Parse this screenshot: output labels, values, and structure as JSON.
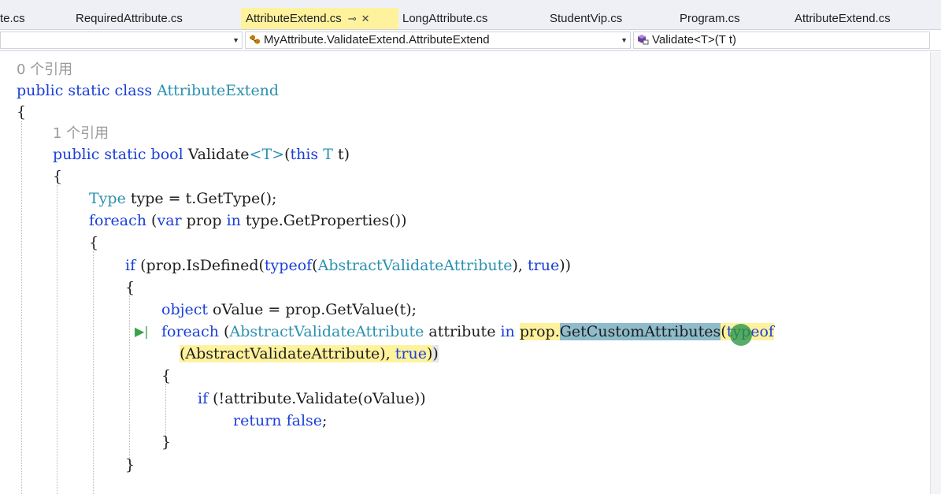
{
  "tabs": [
    {
      "label": "te.cs"
    },
    {
      "label": "RequiredAttribute.cs"
    },
    {
      "label": "AttributeExtend.cs",
      "active": true
    },
    {
      "label": "LongAttribute.cs"
    },
    {
      "label": "StudentVip.cs"
    },
    {
      "label": "Program.cs"
    },
    {
      "label": "AttributeExtend.cs"
    }
  ],
  "tab_controls": {
    "pin": "⊸",
    "close": "✕"
  },
  "nav": {
    "project_combo": "",
    "type_combo": "MyAttribute.ValidateExtend.AttributeExtend",
    "member_combo": "Validate<T>(T t)"
  },
  "code": {
    "ref0": "0 个引用",
    "l_class": {
      "kw1": "public",
      "kw2": "static",
      "kw3": "class",
      "name": "AttributeExtend"
    },
    "brace_open": "{",
    "brace_close": "}",
    "ref1": "1 个引用",
    "l_method": {
      "kw1": "public",
      "kw2": "static",
      "kw3": "bool",
      "name": "Validate",
      "lt": "<",
      "tparam": "T",
      "gt": ">",
      "open": "(",
      "kw_this": "this",
      "ptype": "T",
      "rest": " t)"
    },
    "l_type": {
      "ty": "Type",
      "rest": " type = t.GetType();"
    },
    "l_foreach1": {
      "kw": "foreach",
      "open": " (",
      "kw_var": "var",
      "mid": " prop ",
      "kw_in": "in",
      "rest": " type.GetProperties())"
    },
    "l_if1": {
      "kw": "if",
      "a": " (prop.IsDefined(",
      "kw_typeof": "typeof",
      "b": "(",
      "ty": "AbstractValidateAttribute",
      "c": "), ",
      "kw_true": "true",
      "d": "))"
    },
    "l_object": {
      "kw": "object",
      "rest": " oValue = prop.GetValue(t);"
    },
    "l_foreach2": {
      "kw": "foreach",
      "a": " (",
      "ty": "AbstractValidateAttribute",
      "b": " attribute ",
      "kw_in": "in",
      "sp": " ",
      "hl1": "prop.",
      "sel": "GetCustomAttributes",
      "hl2": "(",
      "kw_typeof": "typeof"
    },
    "l_foreach2_cont": {
      "a": "(AbstractValidateAttribute), ",
      "kw_true": "true",
      "b": ")",
      "c": ")"
    },
    "l_if2": {
      "kw": "if",
      "rest": " (!attribute.Validate(oValue))"
    },
    "l_return": {
      "kw1": "return",
      "kw2": "false",
      "semi": ";"
    }
  },
  "colors": {
    "keyword": "#1a3fd9",
    "type": "#2b91af",
    "highlight": "#fff29d",
    "selection": "#8fbccb"
  }
}
